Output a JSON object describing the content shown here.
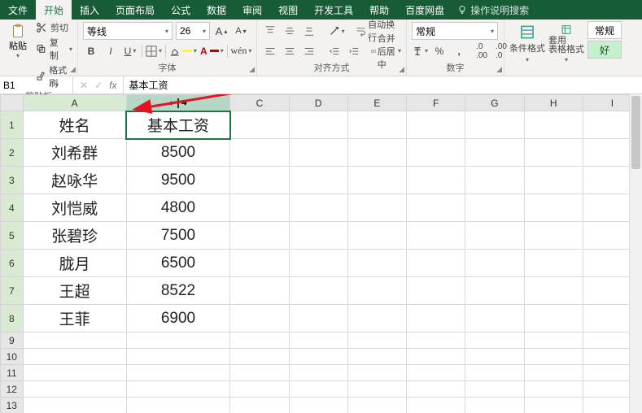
{
  "tabs": {
    "file": "文件",
    "home": "开始",
    "insert": "插入",
    "layout": "页面布局",
    "formulas": "公式",
    "data": "数据",
    "review": "审阅",
    "view": "视图",
    "dev": "开发工具",
    "help": "帮助",
    "baidu": "百度网盘",
    "tellme": "操作说明搜索"
  },
  "ribbon": {
    "paste": "粘贴",
    "cut": "剪切",
    "copy": "复制",
    "format_painter": "格式刷",
    "clipboard_group": "剪贴板",
    "font_name": "等线",
    "font_size": "26",
    "font_group": "字体",
    "wrap": "自动换行",
    "merge": "合并后居中",
    "align_group": "对齐方式",
    "number_format": "常规",
    "number_group": "数字",
    "cond_format": "条件格式",
    "table_format": "套用\n表格格式",
    "normal_style": "常规",
    "good_style": "好"
  },
  "namebox": "B1",
  "formula": "基本工资",
  "columns": [
    "A",
    "B",
    "C",
    "D",
    "E",
    "F",
    "G",
    "H",
    "I"
  ],
  "row_numbers": [
    1,
    2,
    3,
    4,
    5,
    6,
    7,
    8,
    9,
    10,
    11,
    12,
    13
  ],
  "headers": {
    "A": "姓名",
    "B": "基本工资"
  },
  "rows": [
    {
      "name": "刘希群",
      "salary": "8500"
    },
    {
      "name": "赵咏华",
      "salary": "9500"
    },
    {
      "name": "刘恺威",
      "salary": "4800"
    },
    {
      "name": "张碧珍",
      "salary": "7500"
    },
    {
      "name": "胧月",
      "salary": "6500"
    },
    {
      "name": "王超",
      "salary": "8522"
    },
    {
      "name": "王菲",
      "salary": "6900"
    }
  ]
}
